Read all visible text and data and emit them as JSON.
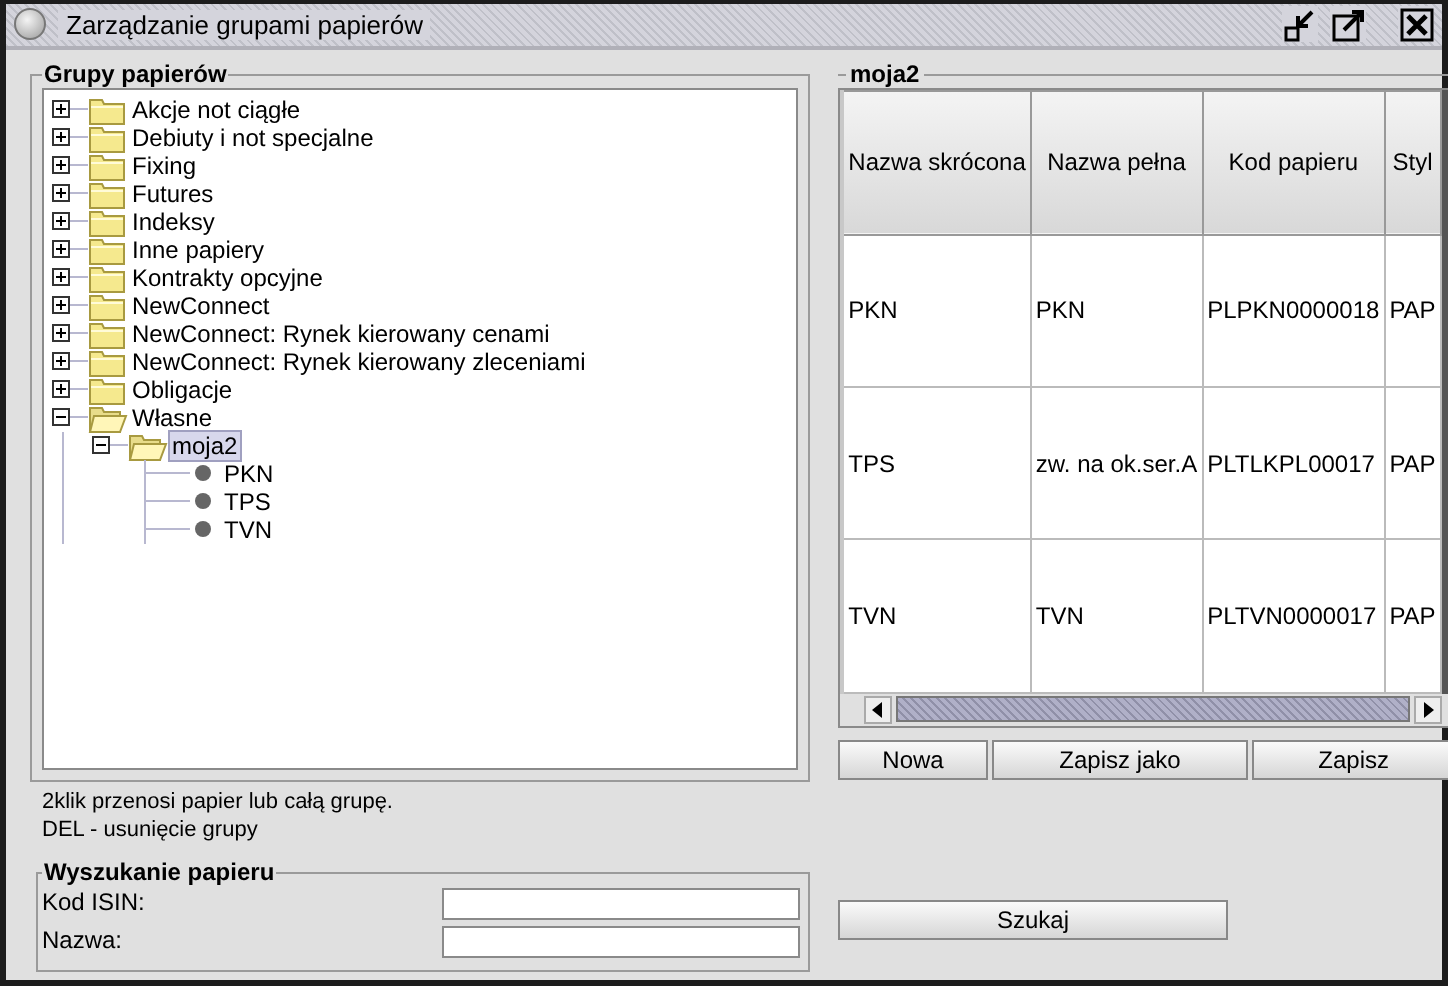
{
  "window": {
    "title": "Zarządzanie grupami papierów"
  },
  "groups_panel": {
    "title": "Grupy papierów",
    "tree": [
      {
        "label": "Akcje not ciągłe",
        "kind": "folder",
        "expanded": false,
        "selected": false
      },
      {
        "label": "Debiuty i not specjalne",
        "kind": "folder",
        "expanded": false,
        "selected": false
      },
      {
        "label": "Fixing",
        "kind": "folder",
        "expanded": false,
        "selected": false
      },
      {
        "label": "Futures",
        "kind": "folder",
        "expanded": false,
        "selected": false
      },
      {
        "label": "Indeksy",
        "kind": "folder",
        "expanded": false,
        "selected": false
      },
      {
        "label": "Inne papiery",
        "kind": "folder",
        "expanded": false,
        "selected": false
      },
      {
        "label": "Kontrakty opcyjne",
        "kind": "folder",
        "expanded": false,
        "selected": false
      },
      {
        "label": "NewConnect",
        "kind": "folder",
        "expanded": false,
        "selected": false
      },
      {
        "label": "NewConnect: Rynek kierowany cenami",
        "kind": "folder",
        "expanded": false,
        "selected": false
      },
      {
        "label": "NewConnect: Rynek kierowany zleceniami",
        "kind": "folder",
        "expanded": false,
        "selected": false
      },
      {
        "label": "Obligacje",
        "kind": "folder",
        "expanded": false,
        "selected": false
      },
      {
        "label": "Własne",
        "kind": "folder",
        "expanded": true,
        "selected": false,
        "children": [
          {
            "label": "moja2",
            "kind": "folder",
            "expanded": true,
            "selected": true,
            "children": [
              {
                "label": "PKN",
                "kind": "leaf",
                "selected": false
              },
              {
                "label": "TPS",
                "kind": "leaf",
                "selected": false
              },
              {
                "label": "TVN",
                "kind": "leaf",
                "selected": false
              }
            ]
          }
        ]
      }
    ]
  },
  "hints": [
    "2klik przenosi papier lub całą grupę.",
    "DEL - usunięcie grupy"
  ],
  "search_panel": {
    "title": "Wyszukanie papieru",
    "fields": [
      {
        "label": "Kod ISIN:"
      },
      {
        "label": "Nazwa:"
      }
    ]
  },
  "group_panel": {
    "title": "moja2",
    "table": {
      "columns": [
        "Nazwa skrócona",
        "Nazwa pełna",
        "Kod papieru",
        "Styl"
      ],
      "rows": [
        [
          "PKN",
          "PKN",
          "PLPKN0000018",
          "PAP"
        ],
        [
          "TPS",
          "zw. na ok.ser.A",
          "PLTLKPL00017",
          "PAP"
        ],
        [
          "TVN",
          "TVN",
          "PLTVN0000017",
          "PAP"
        ]
      ]
    },
    "buttons": [
      "Nowa",
      "Zapisz jako",
      "Zapisz"
    ],
    "search_button": "Szukaj"
  }
}
